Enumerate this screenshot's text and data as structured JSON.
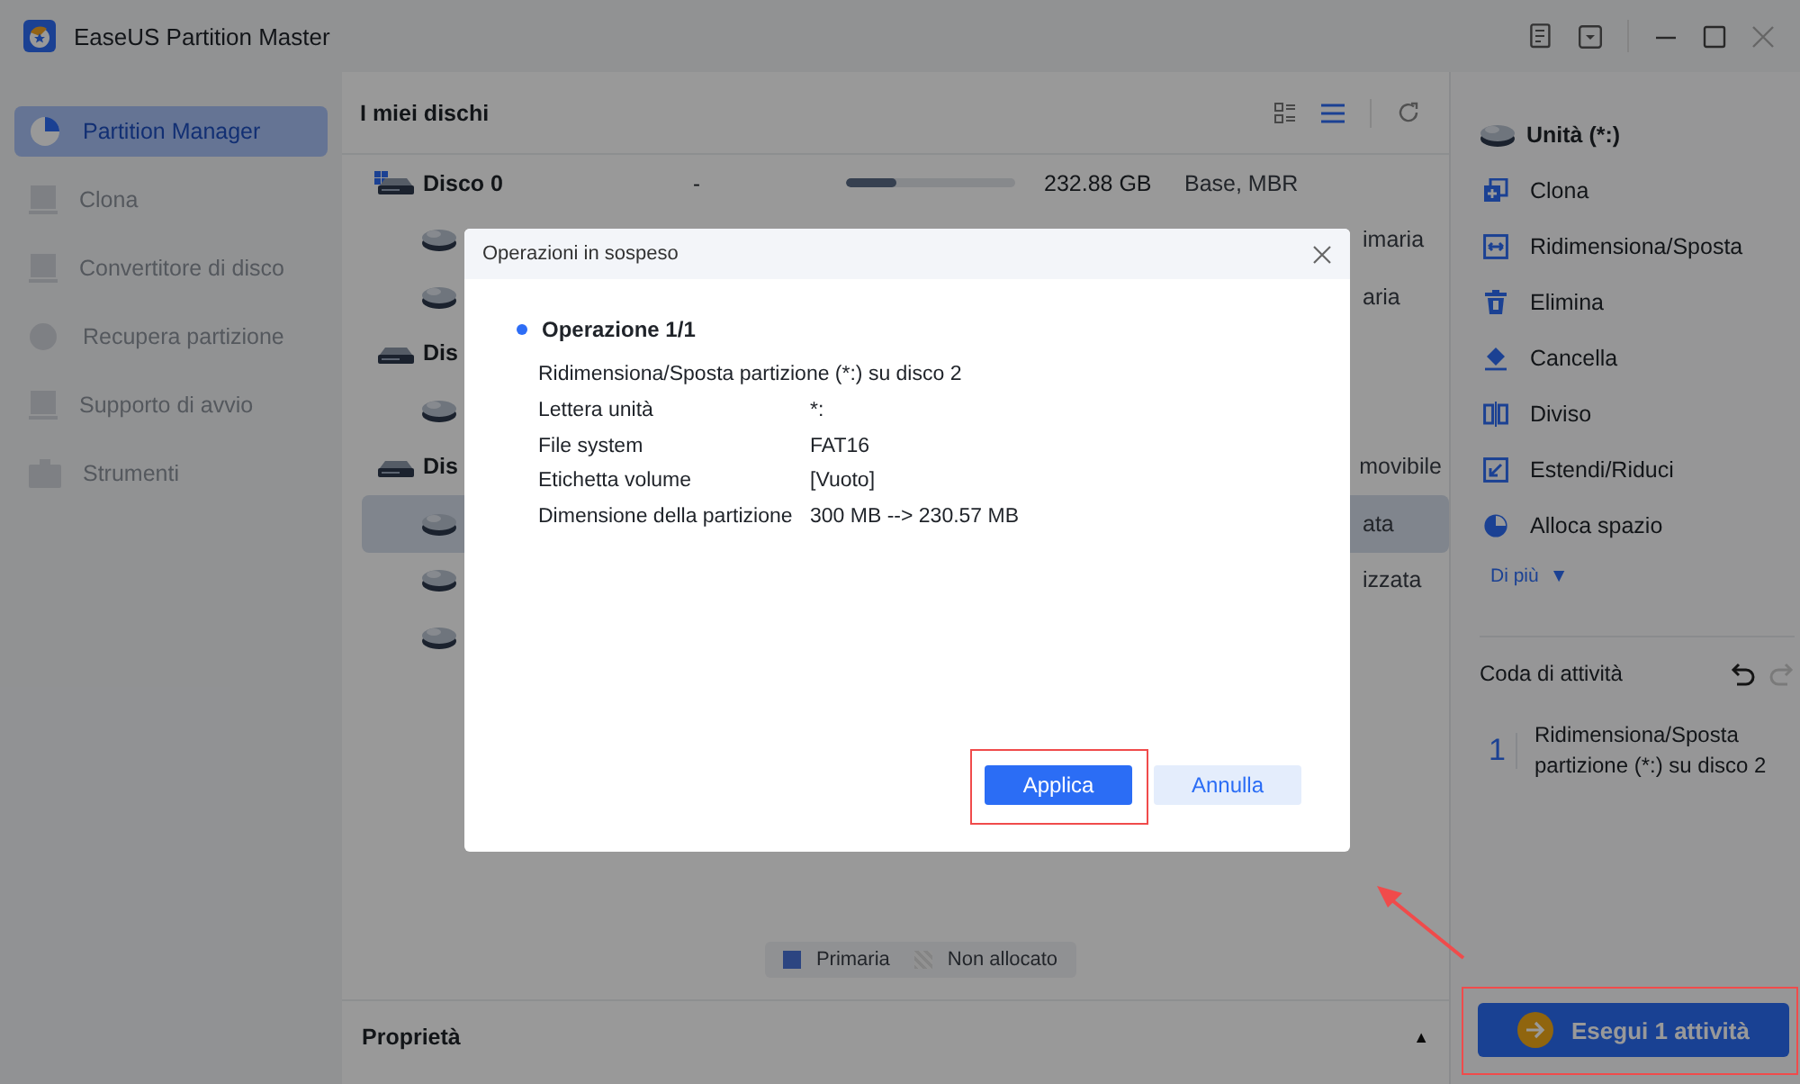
{
  "window": {
    "title": "EaseUS Partition Master"
  },
  "sidebar": {
    "items": [
      {
        "label": "Partition Manager",
        "selected": true
      },
      {
        "label": "Clona",
        "selected": false
      },
      {
        "label": "Convertitore di disco",
        "selected": false
      },
      {
        "label": "Recupera partizione",
        "selected": false
      },
      {
        "label": "Supporto di avvio",
        "selected": false
      },
      {
        "label": "Strumenti",
        "selected": false
      }
    ]
  },
  "disks": {
    "title": "I miei dischi",
    "rows": [
      {
        "kind": "system_disk",
        "name": "Disco 0",
        "column_2": "-",
        "level": 0.3,
        "size": "232.88 GB",
        "type": "Base, MBR",
        "children": [
          {
            "type": "imaria",
            "selected": false
          },
          {
            "type": "aria",
            "selected": false
          }
        ]
      },
      {
        "kind": "disk",
        "name": "Dis",
        "children": [
          {
            "selected": false
          }
        ]
      },
      {
        "kind": "disk",
        "name": "Dis",
        "type": "movibile",
        "children": [
          {
            "type": "ata",
            "selected": true
          },
          {
            "type": "izzata",
            "selected": false
          },
          {
            "selected": false
          }
        ]
      }
    ]
  },
  "legend": [
    {
      "label": "Primaria",
      "kind": "primary"
    },
    {
      "label": "Non allocato",
      "kind": "unallocated"
    }
  ],
  "properties": {
    "title": "Proprietà",
    "toggle": "▲"
  },
  "right_panel": {
    "drive": "Unità (*:)",
    "actions": [
      "Clona",
      "Ridimensiona/Sposta",
      "Elimina",
      "Cancella",
      "Diviso",
      "Estendi/Riduci",
      "Alloca spazio"
    ],
    "more": "Di più",
    "more_caret": "▼",
    "queue": {
      "title": "Coda di attività",
      "items": [
        {
          "number": "1",
          "text": "Ridimensiona/Sposta partizione (*:) su disco 2"
        }
      ]
    },
    "execute_button": "Esegui 1 attività"
  },
  "dialog": {
    "title": "Operazioni in sospeso",
    "heading": "Operazione 1/1",
    "description": "Ridimensiona/Sposta partizione (*:) su disco 2",
    "details": [
      {
        "label": "Lettera unità",
        "value": "*:"
      },
      {
        "label": "File system",
        "value": "FAT16"
      },
      {
        "label": "Etichetta volume",
        "value": "[Vuoto]"
      },
      {
        "label": "Dimensione della partizione",
        "value": "300 MB --> 230.57 MB"
      }
    ],
    "buttons": [
      {
        "label": "Applica",
        "kind": "primary"
      },
      {
        "label": "Annulla",
        "kind": "secondary"
      }
    ]
  }
}
